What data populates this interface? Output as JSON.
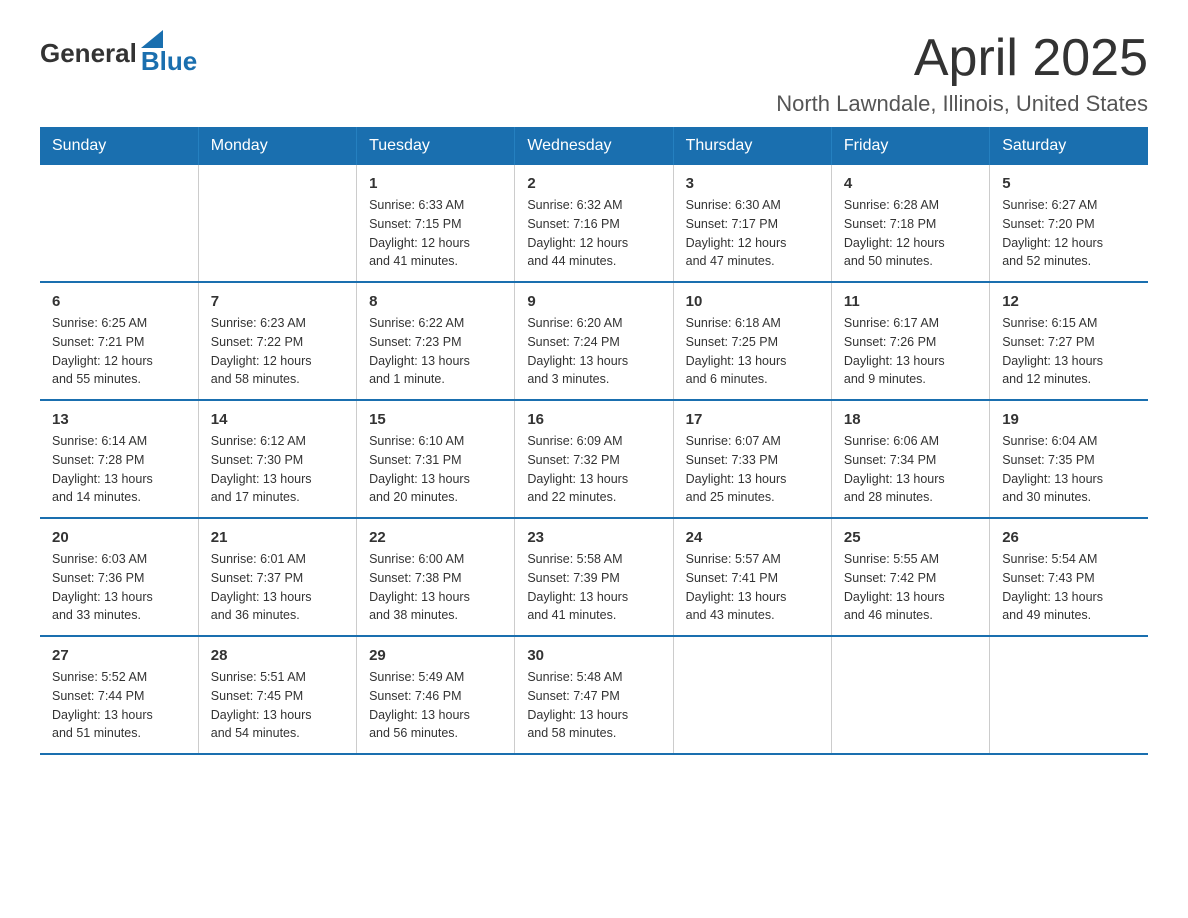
{
  "logo": {
    "general": "General",
    "blue": "Blue"
  },
  "title": "April 2025",
  "location": "North Lawndale, Illinois, United States",
  "weekdays": [
    "Sunday",
    "Monday",
    "Tuesday",
    "Wednesday",
    "Thursday",
    "Friday",
    "Saturday"
  ],
  "weeks": [
    [
      {
        "day": "",
        "info": ""
      },
      {
        "day": "",
        "info": ""
      },
      {
        "day": "1",
        "info": "Sunrise: 6:33 AM\nSunset: 7:15 PM\nDaylight: 12 hours\nand 41 minutes."
      },
      {
        "day": "2",
        "info": "Sunrise: 6:32 AM\nSunset: 7:16 PM\nDaylight: 12 hours\nand 44 minutes."
      },
      {
        "day": "3",
        "info": "Sunrise: 6:30 AM\nSunset: 7:17 PM\nDaylight: 12 hours\nand 47 minutes."
      },
      {
        "day": "4",
        "info": "Sunrise: 6:28 AM\nSunset: 7:18 PM\nDaylight: 12 hours\nand 50 minutes."
      },
      {
        "day": "5",
        "info": "Sunrise: 6:27 AM\nSunset: 7:20 PM\nDaylight: 12 hours\nand 52 minutes."
      }
    ],
    [
      {
        "day": "6",
        "info": "Sunrise: 6:25 AM\nSunset: 7:21 PM\nDaylight: 12 hours\nand 55 minutes."
      },
      {
        "day": "7",
        "info": "Sunrise: 6:23 AM\nSunset: 7:22 PM\nDaylight: 12 hours\nand 58 minutes."
      },
      {
        "day": "8",
        "info": "Sunrise: 6:22 AM\nSunset: 7:23 PM\nDaylight: 13 hours\nand 1 minute."
      },
      {
        "day": "9",
        "info": "Sunrise: 6:20 AM\nSunset: 7:24 PM\nDaylight: 13 hours\nand 3 minutes."
      },
      {
        "day": "10",
        "info": "Sunrise: 6:18 AM\nSunset: 7:25 PM\nDaylight: 13 hours\nand 6 minutes."
      },
      {
        "day": "11",
        "info": "Sunrise: 6:17 AM\nSunset: 7:26 PM\nDaylight: 13 hours\nand 9 minutes."
      },
      {
        "day": "12",
        "info": "Sunrise: 6:15 AM\nSunset: 7:27 PM\nDaylight: 13 hours\nand 12 minutes."
      }
    ],
    [
      {
        "day": "13",
        "info": "Sunrise: 6:14 AM\nSunset: 7:28 PM\nDaylight: 13 hours\nand 14 minutes."
      },
      {
        "day": "14",
        "info": "Sunrise: 6:12 AM\nSunset: 7:30 PM\nDaylight: 13 hours\nand 17 minutes."
      },
      {
        "day": "15",
        "info": "Sunrise: 6:10 AM\nSunset: 7:31 PM\nDaylight: 13 hours\nand 20 minutes."
      },
      {
        "day": "16",
        "info": "Sunrise: 6:09 AM\nSunset: 7:32 PM\nDaylight: 13 hours\nand 22 minutes."
      },
      {
        "day": "17",
        "info": "Sunrise: 6:07 AM\nSunset: 7:33 PM\nDaylight: 13 hours\nand 25 minutes."
      },
      {
        "day": "18",
        "info": "Sunrise: 6:06 AM\nSunset: 7:34 PM\nDaylight: 13 hours\nand 28 minutes."
      },
      {
        "day": "19",
        "info": "Sunrise: 6:04 AM\nSunset: 7:35 PM\nDaylight: 13 hours\nand 30 minutes."
      }
    ],
    [
      {
        "day": "20",
        "info": "Sunrise: 6:03 AM\nSunset: 7:36 PM\nDaylight: 13 hours\nand 33 minutes."
      },
      {
        "day": "21",
        "info": "Sunrise: 6:01 AM\nSunset: 7:37 PM\nDaylight: 13 hours\nand 36 minutes."
      },
      {
        "day": "22",
        "info": "Sunrise: 6:00 AM\nSunset: 7:38 PM\nDaylight: 13 hours\nand 38 minutes."
      },
      {
        "day": "23",
        "info": "Sunrise: 5:58 AM\nSunset: 7:39 PM\nDaylight: 13 hours\nand 41 minutes."
      },
      {
        "day": "24",
        "info": "Sunrise: 5:57 AM\nSunset: 7:41 PM\nDaylight: 13 hours\nand 43 minutes."
      },
      {
        "day": "25",
        "info": "Sunrise: 5:55 AM\nSunset: 7:42 PM\nDaylight: 13 hours\nand 46 minutes."
      },
      {
        "day": "26",
        "info": "Sunrise: 5:54 AM\nSunset: 7:43 PM\nDaylight: 13 hours\nand 49 minutes."
      }
    ],
    [
      {
        "day": "27",
        "info": "Sunrise: 5:52 AM\nSunset: 7:44 PM\nDaylight: 13 hours\nand 51 minutes."
      },
      {
        "day": "28",
        "info": "Sunrise: 5:51 AM\nSunset: 7:45 PM\nDaylight: 13 hours\nand 54 minutes."
      },
      {
        "day": "29",
        "info": "Sunrise: 5:49 AM\nSunset: 7:46 PM\nDaylight: 13 hours\nand 56 minutes."
      },
      {
        "day": "30",
        "info": "Sunrise: 5:48 AM\nSunset: 7:47 PM\nDaylight: 13 hours\nand 58 minutes."
      },
      {
        "day": "",
        "info": ""
      },
      {
        "day": "",
        "info": ""
      },
      {
        "day": "",
        "info": ""
      }
    ]
  ]
}
